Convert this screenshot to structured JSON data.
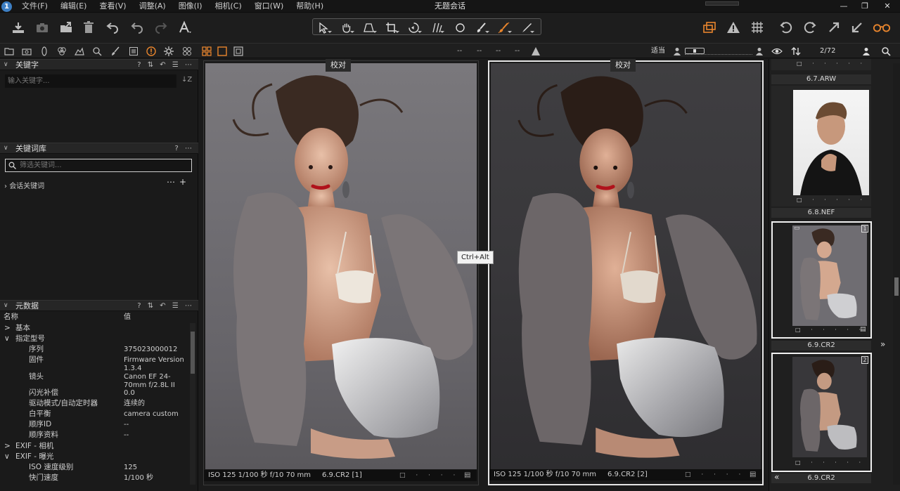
{
  "window": {
    "title": "无题会话",
    "app_icon_label": "1",
    "menu": [
      "文件(F)",
      "编辑(E)",
      "查看(V)",
      "调整(A)",
      "图像(I)",
      "相机(C)",
      "窗口(W)",
      "帮助(H)"
    ],
    "controls": {
      "minimize": "—",
      "maximize": "❐",
      "close": "✕"
    }
  },
  "toolbar": {
    "left_icons": [
      "import-icon",
      "camera-icon",
      "export-icon",
      "trash-icon",
      "undo-all-icon",
      "undo-icon",
      "redo-icon",
      "text-style-icon"
    ],
    "cursor_tools": [
      "select-pointer-icon",
      "pan-hand-icon",
      "keystone-icon",
      "crop-icon",
      "rotate-icon",
      "straighten-icon",
      "spot-removal-icon",
      "brush-icon",
      "eraser-icon",
      "pick-color-icon"
    ],
    "right_icons": [
      "before-after-icon",
      "exposure-warning-icon",
      "grid-icon",
      "rotate-left-icon",
      "rotate-right-icon",
      "expand-icon",
      "collapse-icon",
      "glasses-icon"
    ],
    "accent_color": "#e8852d"
  },
  "viewer_bar": {
    "fit_label": "适当",
    "placeholders": [
      "--",
      "--",
      "--",
      "--"
    ]
  },
  "browser_bar": {
    "counter": "2/72"
  },
  "left": {
    "keywords": {
      "title": "关键字",
      "placeholder": "输入关键字..."
    },
    "library": {
      "title": "关键词库",
      "placeholder": "筛选关键词...",
      "group": "会话关键词"
    },
    "metadata": {
      "title": "元数据",
      "col_name": "名称",
      "col_value": "值",
      "rows": [
        {
          "caret": ">",
          "key": "基本",
          "value": ""
        },
        {
          "caret": "∨",
          "key": "指定型号",
          "value": ""
        },
        {
          "caret": "",
          "key": "序列",
          "value": "375023000012"
        },
        {
          "caret": "",
          "key": "固件",
          "value": "Firmware Version 1.3.4"
        },
        {
          "caret": "",
          "key": "镜头",
          "value": "Canon EF 24-70mm f/2.8L II"
        },
        {
          "caret": "",
          "key": "闪光补偿",
          "value": "0.0"
        },
        {
          "caret": "",
          "key": "驱动模式/自动定时器",
          "value": "连续的"
        },
        {
          "caret": "",
          "key": "白平衡",
          "value": "camera custom"
        },
        {
          "caret": "",
          "key": "顺序ID",
          "value": "--"
        },
        {
          "caret": "",
          "key": "顺序资料",
          "value": "--"
        },
        {
          "caret": ">",
          "key": "EXIF - 相机",
          "value": ""
        },
        {
          "caret": "∨",
          "key": "EXIF - 曝光",
          "value": ""
        },
        {
          "caret": "",
          "key": "ISO 速度级别",
          "value": "125"
        },
        {
          "caret": "",
          "key": "快门速度",
          "value": "1/100 秒"
        }
      ]
    }
  },
  "viewer": {
    "proof_label": "校对",
    "tooltip": "Ctrl+Alt",
    "images": [
      {
        "info": "ISO 125 1/100 秒 f/10 70 mm",
        "name": "6.9.CR2 [1]"
      },
      {
        "info": "ISO 125 1/100 秒 f/10 70 mm",
        "name": "6.9.CR2 [2]"
      }
    ]
  },
  "browser": {
    "items": [
      {
        "name": "6.7.ARW"
      },
      {
        "name": "6.8.NEF"
      },
      {
        "name": "6.9.CR2",
        "badge": "1"
      },
      {
        "name": "6.9.CR2",
        "badge": "2"
      }
    ]
  }
}
